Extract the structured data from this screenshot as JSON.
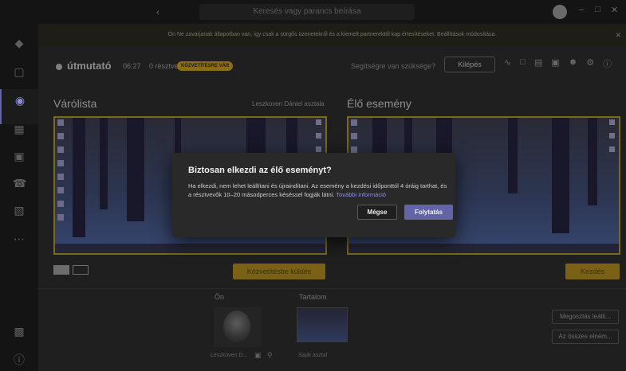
{
  "titlebar": {
    "search_placeholder": "Keresés vagy parancs beírása"
  },
  "banner": {
    "text": "Ön Ne zavarjanak állapotban van, így csak a sürgős üzenetekről és a kiemelt partnerektől kap értesítéseket. Beállítások módosítása."
  },
  "meeting": {
    "title": "útmutató",
    "time": "06:27",
    "participants": "0 résztvevő",
    "badge": "KÖZVETÍTÉSRE VÁR",
    "help": "Segítségre van szüksége?",
    "exit": "Kilépés"
  },
  "left_panel": {
    "title": "Várólista",
    "host": "Leszkoven Dániel asztala"
  },
  "right_panel": {
    "title": "Élő esemény"
  },
  "actions": {
    "send": "Közvetítésbe küldés",
    "start": "Kezdés"
  },
  "bottom": {
    "me_header": "Ön",
    "content_header": "Tartalom",
    "me_name": "Leszkoven D...",
    "content_name": "Saját asztal",
    "stop_share": "Megosztás leállí...",
    "mute_all": "Az összes elném..."
  },
  "dialog": {
    "title": "Biztosan elkezdi az élő eseményt?",
    "body": "Ha elkezdi, nem lehet leállítani és újraindítani. Az esemény a kezdési időponttól 4 óráig tarthat, és a résztvevők 10–20 másodperces késéssel fogják látni.",
    "link": "További információ",
    "cancel": "Mégse",
    "confirm": "Folytatás"
  },
  "colors": {
    "accent": "#6264a7",
    "frame": "#7a6a1c",
    "badge": "#8a6d1a"
  }
}
